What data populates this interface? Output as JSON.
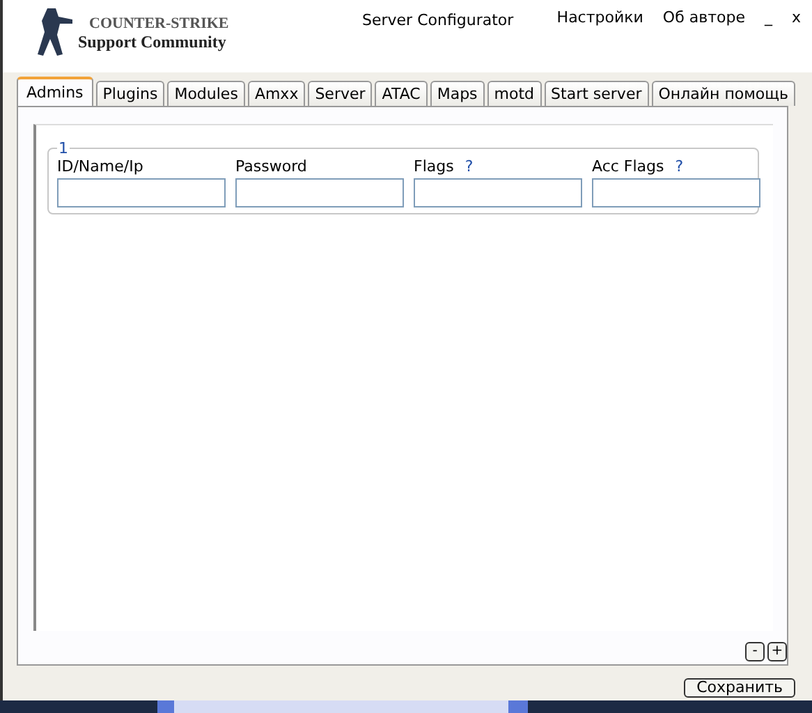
{
  "logo": {
    "title": "COUNTER-STRIKE",
    "subtitle": "Support Community"
  },
  "window": {
    "title": "Server Configurator"
  },
  "menu": [
    {
      "label": "Настройки"
    },
    {
      "label": "Об авторе"
    }
  ],
  "window_controls": [
    {
      "label": "_"
    },
    {
      "label": "x"
    }
  ],
  "tabs": [
    {
      "label": "Admins",
      "selected": true
    },
    {
      "label": "Plugins",
      "selected": false
    },
    {
      "label": "Modules",
      "selected": false
    },
    {
      "label": "Amxx",
      "selected": false
    },
    {
      "label": "Server",
      "selected": false
    },
    {
      "label": "ATAC",
      "selected": false
    },
    {
      "label": "Maps",
      "selected": false
    },
    {
      "label": "motd",
      "selected": false
    },
    {
      "label": "Start server",
      "selected": false
    },
    {
      "label": "Онлайн помощь",
      "selected": false
    }
  ],
  "admin_entry": {
    "number": "1",
    "fields": [
      {
        "label": "ID/Name/Ip"
      },
      {
        "label": "Password"
      },
      {
        "label": "Flags",
        "help": "?"
      },
      {
        "label": "Acc Flags",
        "help": "?"
      }
    ]
  },
  "row_buttons": [
    {
      "label": "-"
    },
    {
      "label": "+"
    }
  ],
  "save_button": {
    "label": "Сохранить"
  }
}
